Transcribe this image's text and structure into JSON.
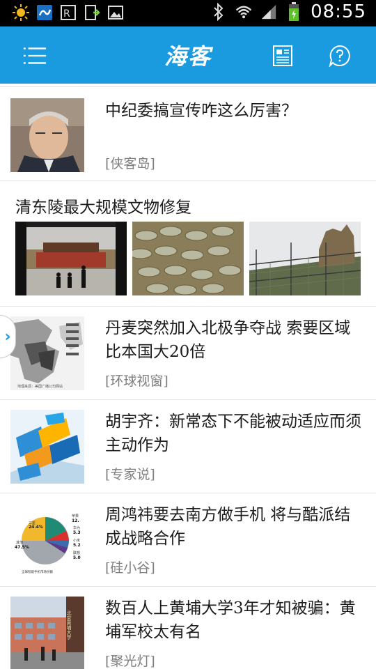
{
  "status_bar": {
    "time": "08:55",
    "icons": [
      "sun-icon",
      "app-icon",
      "text-icon",
      "download-icon",
      "image-icon",
      "bluetooth-icon",
      "wifi-icon",
      "signal-icon",
      "battery-icon"
    ]
  },
  "header": {
    "title": "海客",
    "buttons": [
      "menu-icon",
      "newspaper-icon",
      "help-icon"
    ]
  },
  "colors": {
    "brand": "#1a9be0",
    "text": "#1c1c1c",
    "source": "#7f7f7f"
  },
  "feed": {
    "items": [
      {
        "headline": "中纪委搞宣传咋这么厉害？",
        "source": "[侠客岛]"
      },
      {
        "headline": "丹麦突然加入北极争夺战 索要区域比本国大20倍",
        "source": "[环球视窗]"
      },
      {
        "headline": "胡宇齐：新常态下不能被动适应而须主动作为",
        "source": "[专家说]"
      },
      {
        "headline": "周鸿祎要去南方做手机 将与酷派结成战略合作",
        "source": "[硅小谷]"
      },
      {
        "headline": "数百人上黄埔大学3年才知被骗：黄埔军校太有名",
        "source": "[聚光灯]"
      }
    ],
    "gallery": {
      "title": "清东陵最大规模文物修复"
    },
    "thumb_texts": {
      "map_caption": "地理来源：美国广播公司网站",
      "pie_labels": [
        "三星",
        "24.4%",
        "其他",
        "47.5%",
        "苹果",
        "12.",
        "华为",
        "5.3",
        "小米",
        "5.2",
        "联想",
        "5.0",
        "全球智能手机市场份额"
      ],
      "gate_sign": "北京黄埔大学"
    }
  }
}
